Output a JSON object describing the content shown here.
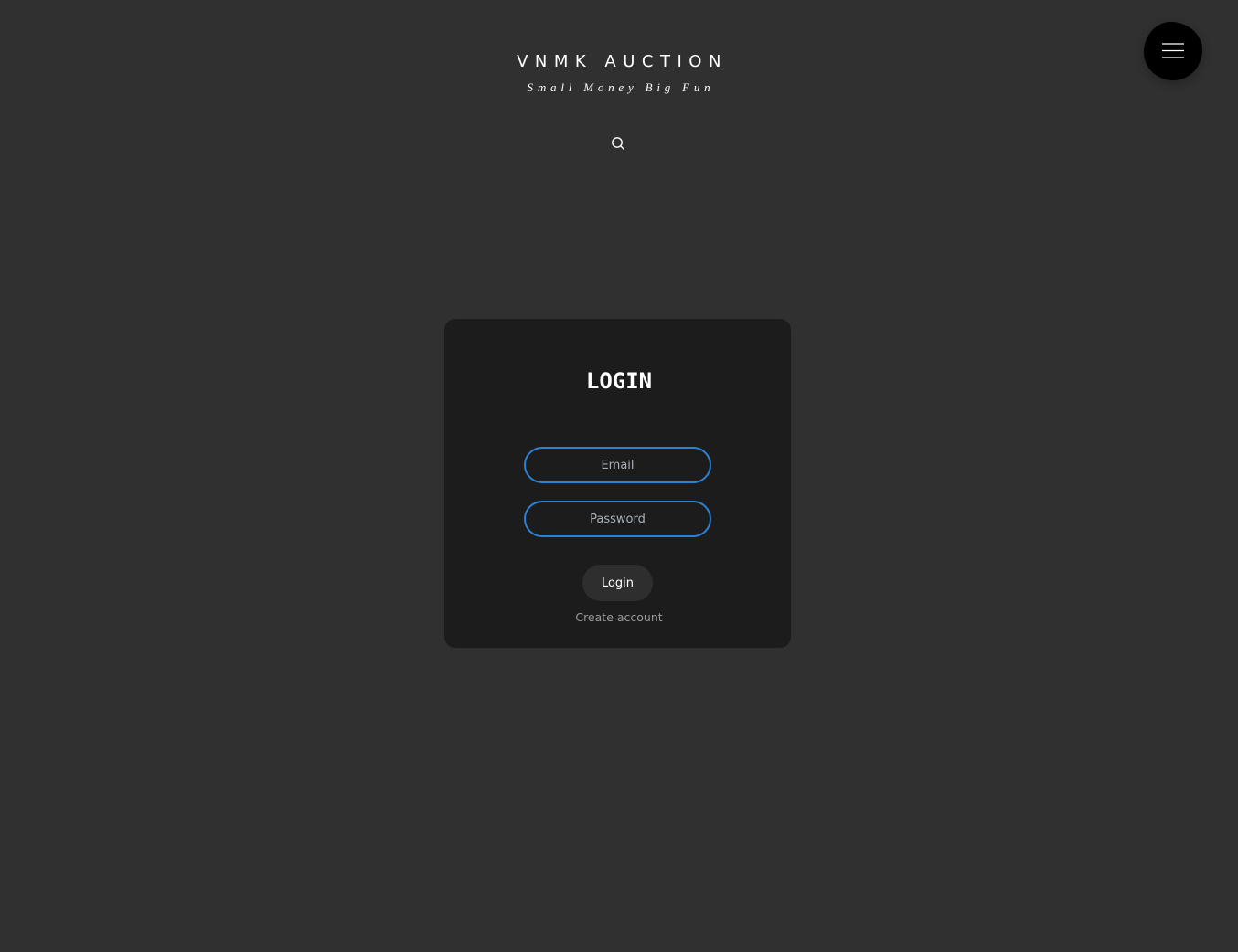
{
  "header": {
    "site_title": "VNMK AUCTION",
    "tagline": "Small Money Big Fun",
    "search_icon": "search-icon",
    "menu_icon": "hamburger-menu-icon"
  },
  "login": {
    "heading": "LOGIN",
    "email_placeholder": "Email",
    "password_placeholder": "Password",
    "login_button_label": "Login",
    "create_account_label": "Create account"
  },
  "colors": {
    "page_background": "#303030",
    "card_background": "#1c1c1c",
    "input_border": "#2a82d6",
    "menu_button": "#000000",
    "login_button": "#2e2e2e"
  }
}
